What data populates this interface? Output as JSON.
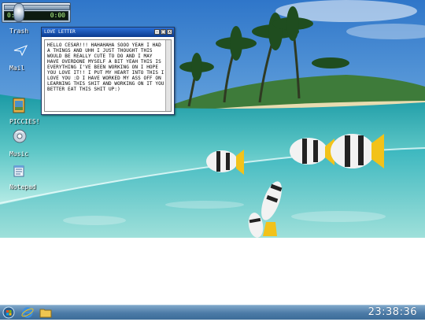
{
  "media_player": {
    "time_left": "0:0",
    "time_right": "0:00"
  },
  "desktop_icons": [
    {
      "label": "Trash",
      "icon": "trash-icon"
    },
    {
      "label": "Mail",
      "icon": "mail-icon"
    },
    {
      "label": "PICCIES!",
      "icon": "pictures-folder-icon"
    },
    {
      "label": "Music",
      "icon": "music-icon"
    },
    {
      "label": "Notepad",
      "icon": "notepad-icon"
    }
  ],
  "window": {
    "title": "LOVE LETTER",
    "body": "HELLO CESAR!!! HAHAHAHA SOOO YEAH I HAD A THINGS AND UHH I JUST THOUGHT THIS WOULD BE REALLY CUTE TO DO AND I MAY HAVE OVERDONE MYSELF A BIT YEAH THIS IS EVERYTHING I'VE BEEN WORKING ON I HOPE YOU LOVE IT!! I PUT MY HEART INTO THIS I LOVE YOU :D I HAVE WORKED MY ASS OFF ON LEARNING THIS SHIT AND WORKING ON IT YOU BETTER EAT THIS SHIT UP:)"
  },
  "taskbar": {
    "buttons": [
      "start-orb-icon",
      "internet-explorer-icon",
      "folder-icon"
    ],
    "clock": "23:38:36"
  },
  "colors": {
    "taskbar": "#4b7aa6",
    "title_bar": "#0a3a8e"
  }
}
